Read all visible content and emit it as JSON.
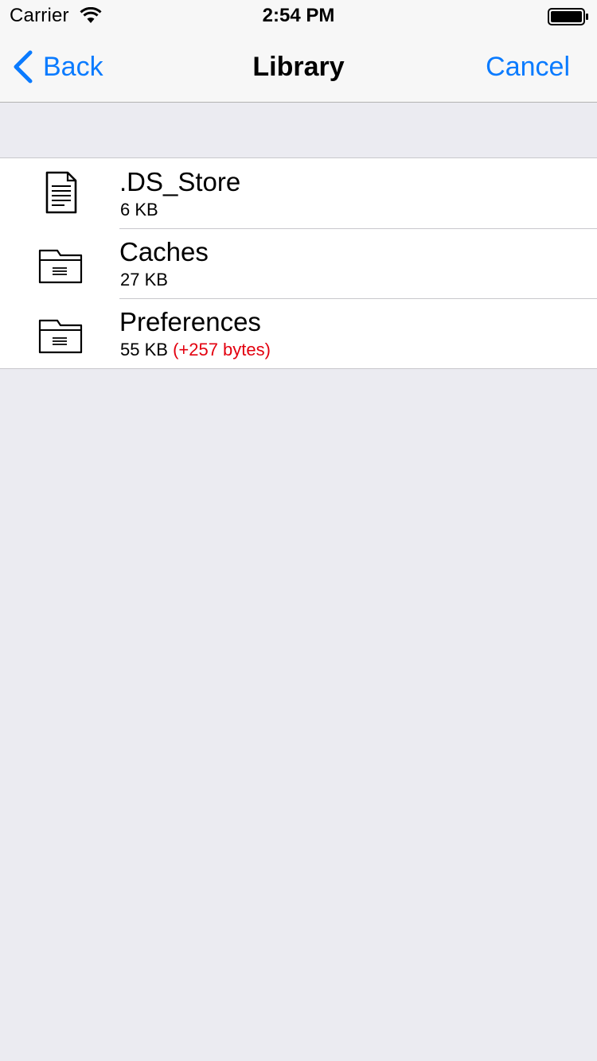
{
  "status_bar": {
    "carrier": "Carrier",
    "time": "2:54 PM",
    "wifi_icon": "wifi-icon",
    "battery_icon": "battery-full-icon"
  },
  "nav_bar": {
    "back_label": "Back",
    "title": "Library",
    "cancel_label": "Cancel",
    "accent_color": "#0a7bff"
  },
  "files": [
    {
      "name": ".DS_Store",
      "size": "6 KB",
      "delta": "",
      "icon": "document-icon"
    },
    {
      "name": "Caches",
      "size": "27 KB",
      "delta": "",
      "icon": "folder-icon"
    },
    {
      "name": "Preferences",
      "size": "55 KB",
      "delta": "(+257 bytes)",
      "icon": "folder-icon"
    }
  ],
  "colors": {
    "background": "#ebebf1",
    "delta_text": "#e3000f"
  }
}
